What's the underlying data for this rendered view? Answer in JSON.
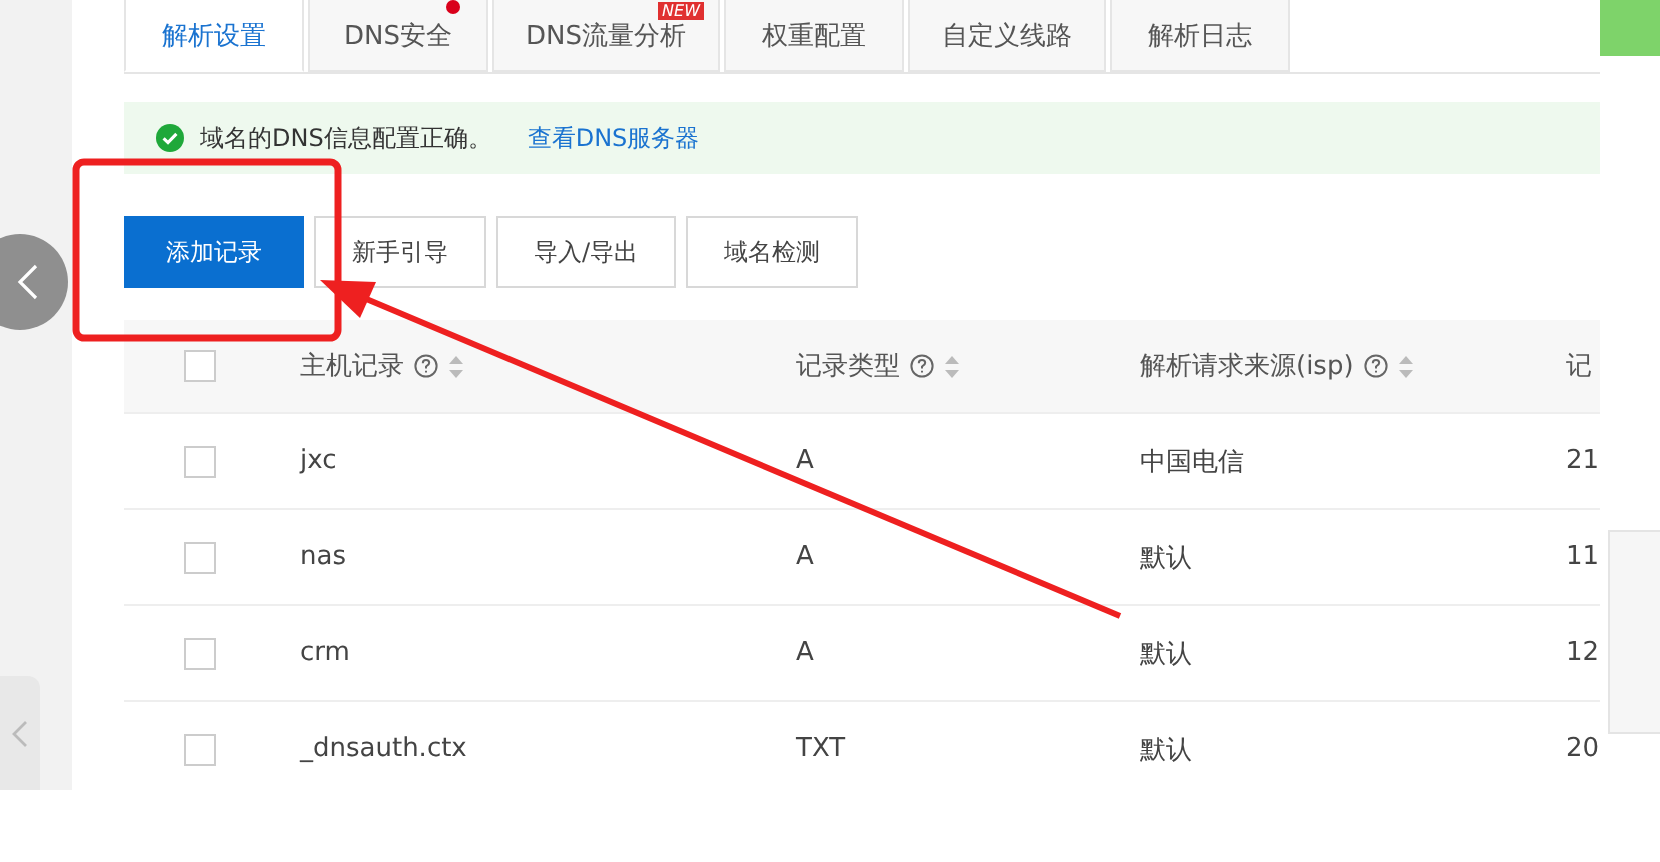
{
  "tabs": [
    {
      "label": "解析设置",
      "selected": true
    },
    {
      "label": "DNS安全",
      "selected": false,
      "badge": {
        "kind": "dot"
      }
    },
    {
      "label": "DNS流量分析",
      "selected": false,
      "badge": {
        "kind": "new",
        "text": "NEW"
      }
    },
    {
      "label": "权重配置",
      "selected": false
    },
    {
      "label": "自定义线路",
      "selected": false
    },
    {
      "label": "解析日志",
      "selected": false
    }
  ],
  "alert": {
    "message": "域名的DNS信息配置正确。",
    "link": "查看DNS服务器"
  },
  "buttons": [
    {
      "label": "添加记录",
      "primary": true
    },
    {
      "label": "新手引导",
      "primary": false
    },
    {
      "label": "导入/导出",
      "primary": false
    },
    {
      "label": "域名检测",
      "primary": false
    }
  ],
  "table": {
    "header_checked": false,
    "columns": [
      {
        "label": "主机记录",
        "kind": "sortable"
      },
      {
        "label": "记录类型",
        "kind": "sortable"
      },
      {
        "label": "解析请求来源(isp)",
        "kind": "sortable"
      },
      {
        "label": "记",
        "kind": "plain"
      }
    ],
    "rows": [
      {
        "checked": false,
        "cells": [
          "jxc",
          "A",
          "中国电信",
          "21"
        ]
      },
      {
        "checked": false,
        "cells": [
          "nas",
          "A",
          "默认",
          "11"
        ]
      },
      {
        "checked": false,
        "cells": [
          "crm",
          "A",
          "默认",
          "12"
        ]
      },
      {
        "checked": false,
        "cells": [
          "_dnsauth.ctx",
          "TXT",
          "默认",
          "20"
        ]
      }
    ]
  }
}
